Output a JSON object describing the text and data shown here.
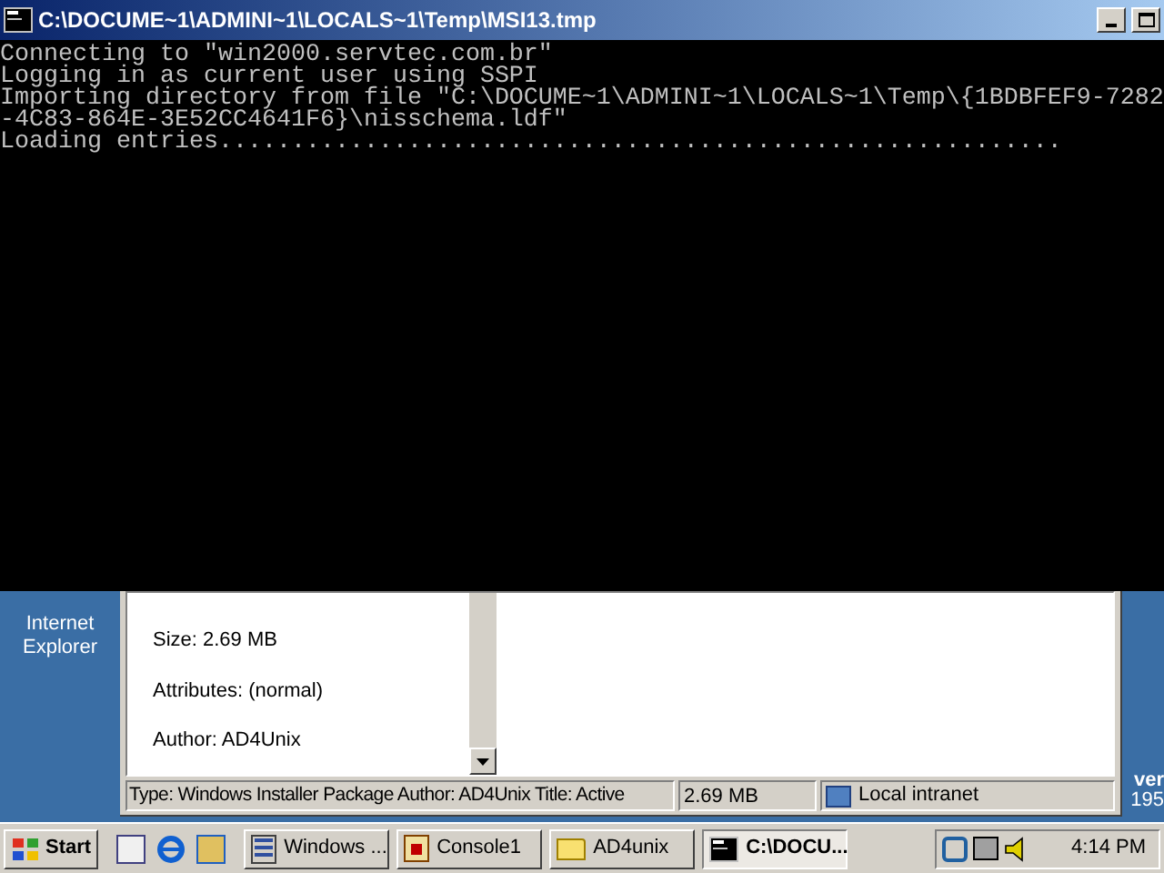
{
  "console": {
    "title": "C:\\DOCUME~1\\ADMINI~1\\LOCALS~1\\Temp\\MSI13.tmp",
    "lines": [
      "Connecting to \"win2000.servtec.com.br\"",
      "Logging in as current user using SSPI",
      "Importing directory from file \"C:\\DOCUME~1\\ADMINI~1\\LOCALS~1\\Temp\\{1BDBFEF9-7282",
      "-4C83-864E-3E52CC4641F6}\\nisschema.ldf\"",
      "Loading entries.........................................................."
    ]
  },
  "desktop": {
    "icon_label": "Internet Explorer",
    "right_labels": [
      "ver",
      "195"
    ]
  },
  "explorer": {
    "details": [
      "Size: 2.69 MB",
      "Attributes: (normal)",
      "Author: AD4Unix"
    ],
    "status_bar": [
      "Type: Windows Installer Package Author: AD4Unix Title: Active",
      "2.69 MB",
      "Local intranet"
    ]
  },
  "taskbar": {
    "start": "Start",
    "tasks": [
      {
        "label": "Windows ...",
        "kind": "server",
        "selected": false
      },
      {
        "label": "Console1",
        "kind": "console",
        "selected": false
      },
      {
        "label": "AD4unix",
        "kind": "folder",
        "selected": false
      },
      {
        "label": "C:\\DOCU...",
        "kind": "cmd",
        "selected": true
      }
    ],
    "clock": "4:14 PM"
  }
}
